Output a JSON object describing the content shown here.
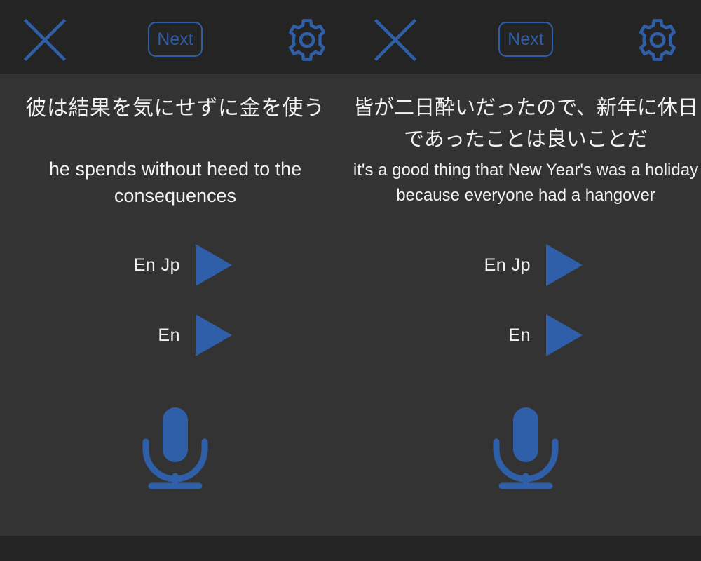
{
  "theme": {
    "accent": "#2f5fa8",
    "bar_background": "#242424",
    "content_background": "#333333",
    "text_color": "#f2f2f2"
  },
  "topbar": {
    "close_icon": "close-icon",
    "next_label": "Next",
    "settings_icon": "gear-icon"
  },
  "panels": [
    {
      "japanese": "彼は結果を気にせずに金を使う",
      "english": "he spends without heed to the consequences",
      "audio_enjp_label": "En Jp",
      "audio_en_label": "En",
      "mic_icon": "microphone-icon",
      "play_icon": "play-icon"
    },
    {
      "japanese": "皆が二日酔いだったので、新年に休日であったことは良いことだ",
      "english": "it's a good thing that New Year's was a holiday because everyone had a hangover",
      "audio_enjp_label": "En Jp",
      "audio_en_label": "En",
      "mic_icon": "microphone-icon",
      "play_icon": "play-icon"
    }
  ]
}
